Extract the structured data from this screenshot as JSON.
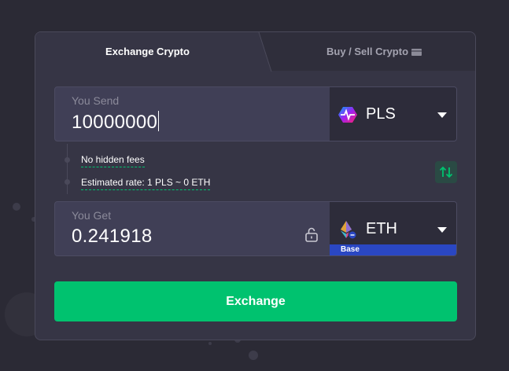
{
  "tabs": {
    "exchange_label": "Exchange Crypto",
    "buy_sell_label": "Buy / Sell Crypto",
    "buy_sell_icon": "credit-card-icon"
  },
  "send": {
    "label": "You Send",
    "value": "10000000",
    "currency": "PLS",
    "currency_icon": "pulsechain-logo-icon"
  },
  "info": {
    "fees_text": "No hidden fees",
    "rate_text": "Estimated rate: 1 PLS ~ 0 ETH",
    "swap_icon": "swap-arrows-icon"
  },
  "get": {
    "label": "You Get",
    "value": "0.241918",
    "lock_icon": "unlock-icon",
    "currency": "ETH",
    "currency_icon": "ethereum-logo-icon",
    "network": "Base"
  },
  "action": {
    "exchange_label": "Exchange"
  },
  "colors": {
    "accent": "#00c26f",
    "network_badge": "#2a47c3",
    "panel": "#363545",
    "background": "#2b2a35"
  }
}
